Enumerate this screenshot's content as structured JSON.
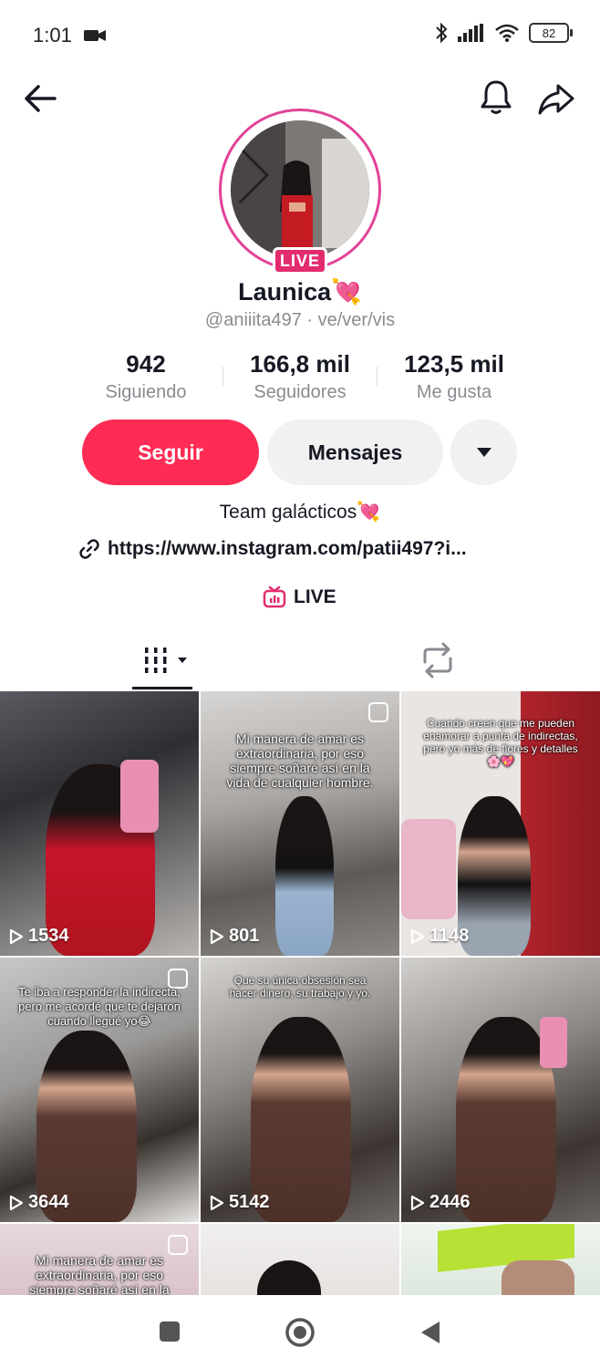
{
  "status_bar": {
    "time": "1:01",
    "battery": "82"
  },
  "profile": {
    "display_name": "Launica💘",
    "username": "@aniiita497 · ve/ver/vis",
    "live_badge": "LIVE",
    "stats": [
      {
        "value": "942",
        "label": "Siguiendo"
      },
      {
        "value": "166,8 mil",
        "label": "Seguidores"
      },
      {
        "value": "123,5 mil",
        "label": "Me gusta"
      }
    ],
    "follow_label": "Seguir",
    "message_label": "Mensajes",
    "bio": "Team galácticos💘",
    "link": "https://www.instagram.com/patii497?i...",
    "live_label": "LIVE"
  },
  "videos": [
    {
      "views": "1534",
      "caption": ""
    },
    {
      "views": "801",
      "caption": "Mi manera de amar es extraordinaria, por eso siempre soñaré así en la vida de cualquier hombre."
    },
    {
      "views": "1148",
      "caption": "Cuando creen que me pueden enamorar a punta de indirectas, pero yo más de flores y detalles🌸💖"
    },
    {
      "views": "3644",
      "caption": "Te iba a responder la indirecta, pero me acordé que te dejaron cuando llegué yo😂"
    },
    {
      "views": "5142",
      "caption": "Que su única obsesión sea hacer dinero, su trabajo y yo."
    },
    {
      "views": "2446",
      "caption": ""
    },
    {
      "views": "",
      "caption": "Mi manera de amar es extraordinaria, por eso siempre soñaré así en la vida"
    },
    {
      "views": "",
      "caption": ""
    },
    {
      "views": "",
      "caption": ""
    }
  ],
  "colors": {
    "accent": "#fe2c55",
    "live": "#e32c6f",
    "ring": "#e24398"
  }
}
